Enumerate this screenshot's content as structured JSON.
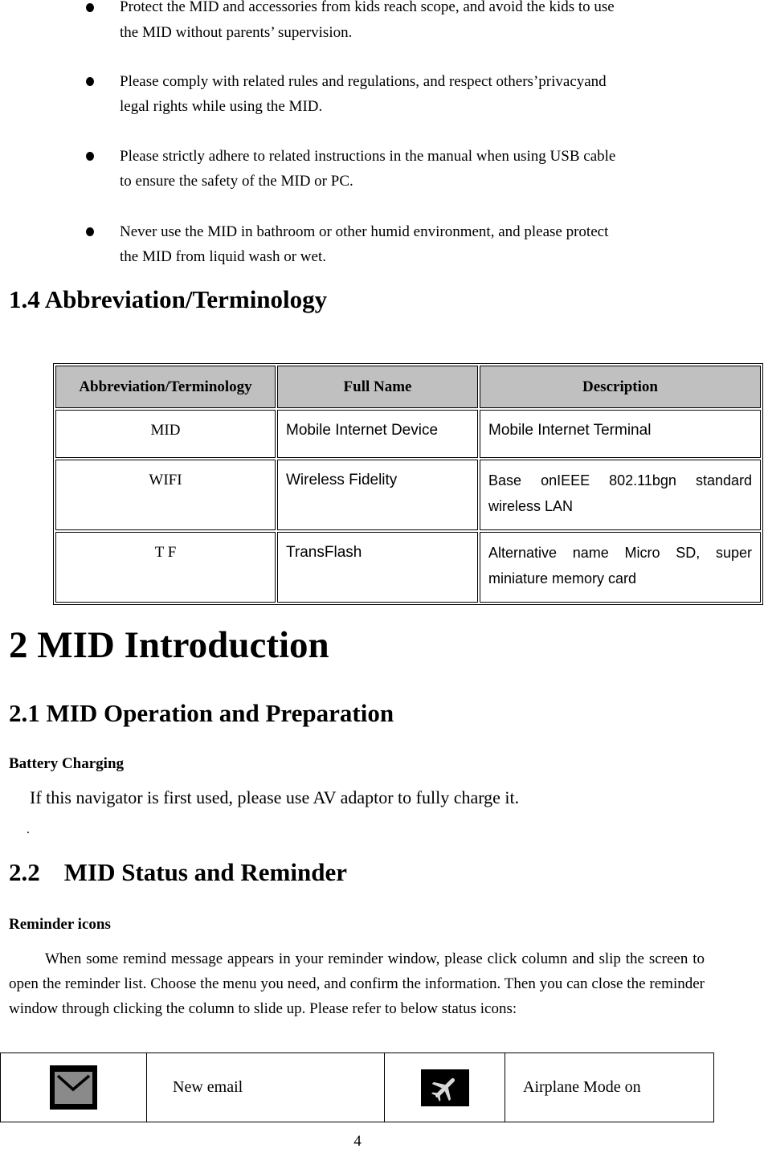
{
  "bullets": [
    {
      "lines": [
        "Protect the MID and accessories from kids reach scope, and avoid the kids to use",
        "the MID without parents’ supervision."
      ]
    },
    {
      "lines": [
        "Please comply with related rules and regulations, and respect others’privacyand",
        "legal rights while using the MID."
      ]
    },
    {
      "lines": [
        "Please strictly adhere to related instructions in the manual when using USB cable",
        "to ensure the safety of the MID or PC."
      ]
    },
    {
      "lines": [
        "Never use the MID in bathroom or other humid environment, and please protect",
        "the MID from liquid wash or wet."
      ]
    }
  ],
  "section_1_4": {
    "title": "1.4 Abbreviation/Terminology"
  },
  "abbr_table": {
    "headers": [
      "Abbreviation/Terminology",
      "Full Name",
      "Description"
    ],
    "rows": [
      {
        "abbr": "MID",
        "full": "Mobile Internet Device",
        "desc": "Mobile Internet Terminal"
      },
      {
        "abbr": "WIFI",
        "full": "Wireless Fidelity",
        "desc": "Base onIEEE 802.11bgn standard wireless LAN"
      },
      {
        "abbr": "T F",
        "full": "TransFlash",
        "desc": "Alternative name Micro SD, super miniature memory card"
      }
    ]
  },
  "chapter_2": {
    "title": "2 MID Introduction"
  },
  "section_2_1": {
    "title": "2.1 MID Operation and Preparation",
    "subheading": "Battery Charging",
    "text": "If this navigator is first used, please use AV adaptor to fully charge it.",
    "stray_mark": "."
  },
  "section_2_2": {
    "number": "2.2",
    "title": "MID Status and Reminder",
    "subheading": "Reminder icons",
    "paragraph": "When some remind message appears in your reminder window, please click column and slip the screen to open the reminder list. Choose the menu you need, and confirm the information. Then you can close the reminder window through clicking the column to slide up. Please refer to below status icons:"
  },
  "status_icons": [
    {
      "icon": "email-icon",
      "label": "New email"
    },
    {
      "icon": "airplane-icon",
      "label": "Airplane Mode on"
    }
  ],
  "page_number": "4"
}
